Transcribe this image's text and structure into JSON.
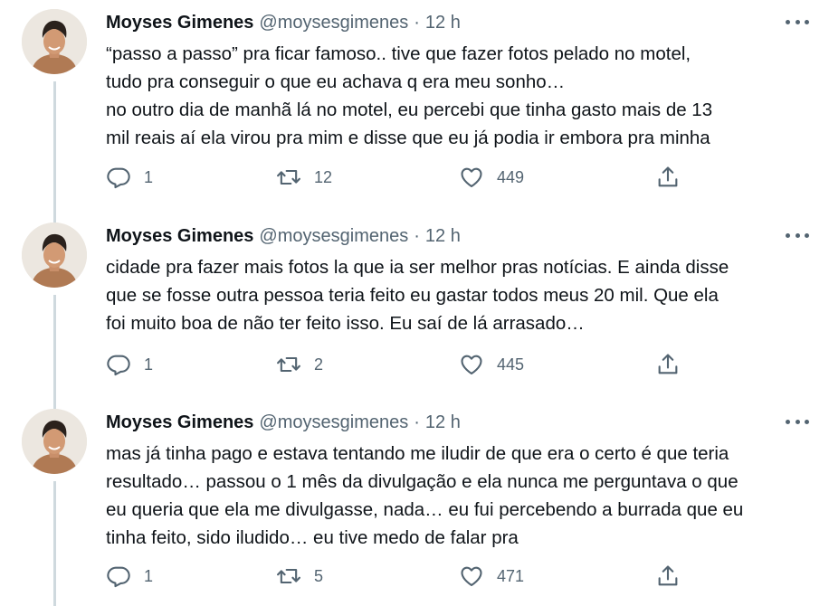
{
  "tweets": [
    {
      "author": {
        "name": "Moyses Gimenes",
        "handle": "@moysesgimenes"
      },
      "time": "12 h",
      "separator": "·",
      "lines": [
        "“passo a passo” pra ficar famoso.. tive que fazer fotos pelado no motel,",
        "tudo pra conseguir o que eu achava q era meu sonho…",
        "no outro dia de manhã lá no motel, eu percebi que tinha gasto mais de 13",
        "mil reais aí ela virou pra mim e disse que eu já podia ir embora pra minha"
      ],
      "stats": {
        "replies": "1",
        "retweets": "12",
        "likes": "449"
      }
    },
    {
      "author": {
        "name": "Moyses Gimenes",
        "handle": "@moysesgimenes"
      },
      "time": "12 h",
      "separator": "·",
      "lines": [
        "cidade pra fazer mais fotos la que ia ser melhor pras notícias. E ainda disse",
        "que se fosse outra pessoa teria feito eu gastar todos meus 20 mil. Que ela",
        "foi muito boa de não ter feito isso. Eu saí de lá arrasado…"
      ],
      "stats": {
        "replies": "1",
        "retweets": "2",
        "likes": "445"
      }
    },
    {
      "author": {
        "name": "Moyses Gimenes",
        "handle": "@moysesgimenes"
      },
      "time": "12 h",
      "separator": "·",
      "lines": [
        "mas já tinha pago e estava tentando me iludir de que era o certo é que teria",
        "resultado… passou o 1 mês da divulgação e ela nunca me perguntava o que",
        "eu queria que ela me divulgasse, nada… eu fui percebendo a burrada que eu",
        "tinha feito, sido iludido… eu tive medo de falar pra"
      ],
      "stats": {
        "replies": "1",
        "retweets": "5",
        "likes": "471"
      }
    }
  ],
  "colors": {
    "text": "#0f1419",
    "secondary": "#536471",
    "thread_line": "#cfd9de"
  },
  "icons": [
    "reply-icon",
    "retweet-icon",
    "like-icon",
    "share-icon",
    "more-icon"
  ]
}
